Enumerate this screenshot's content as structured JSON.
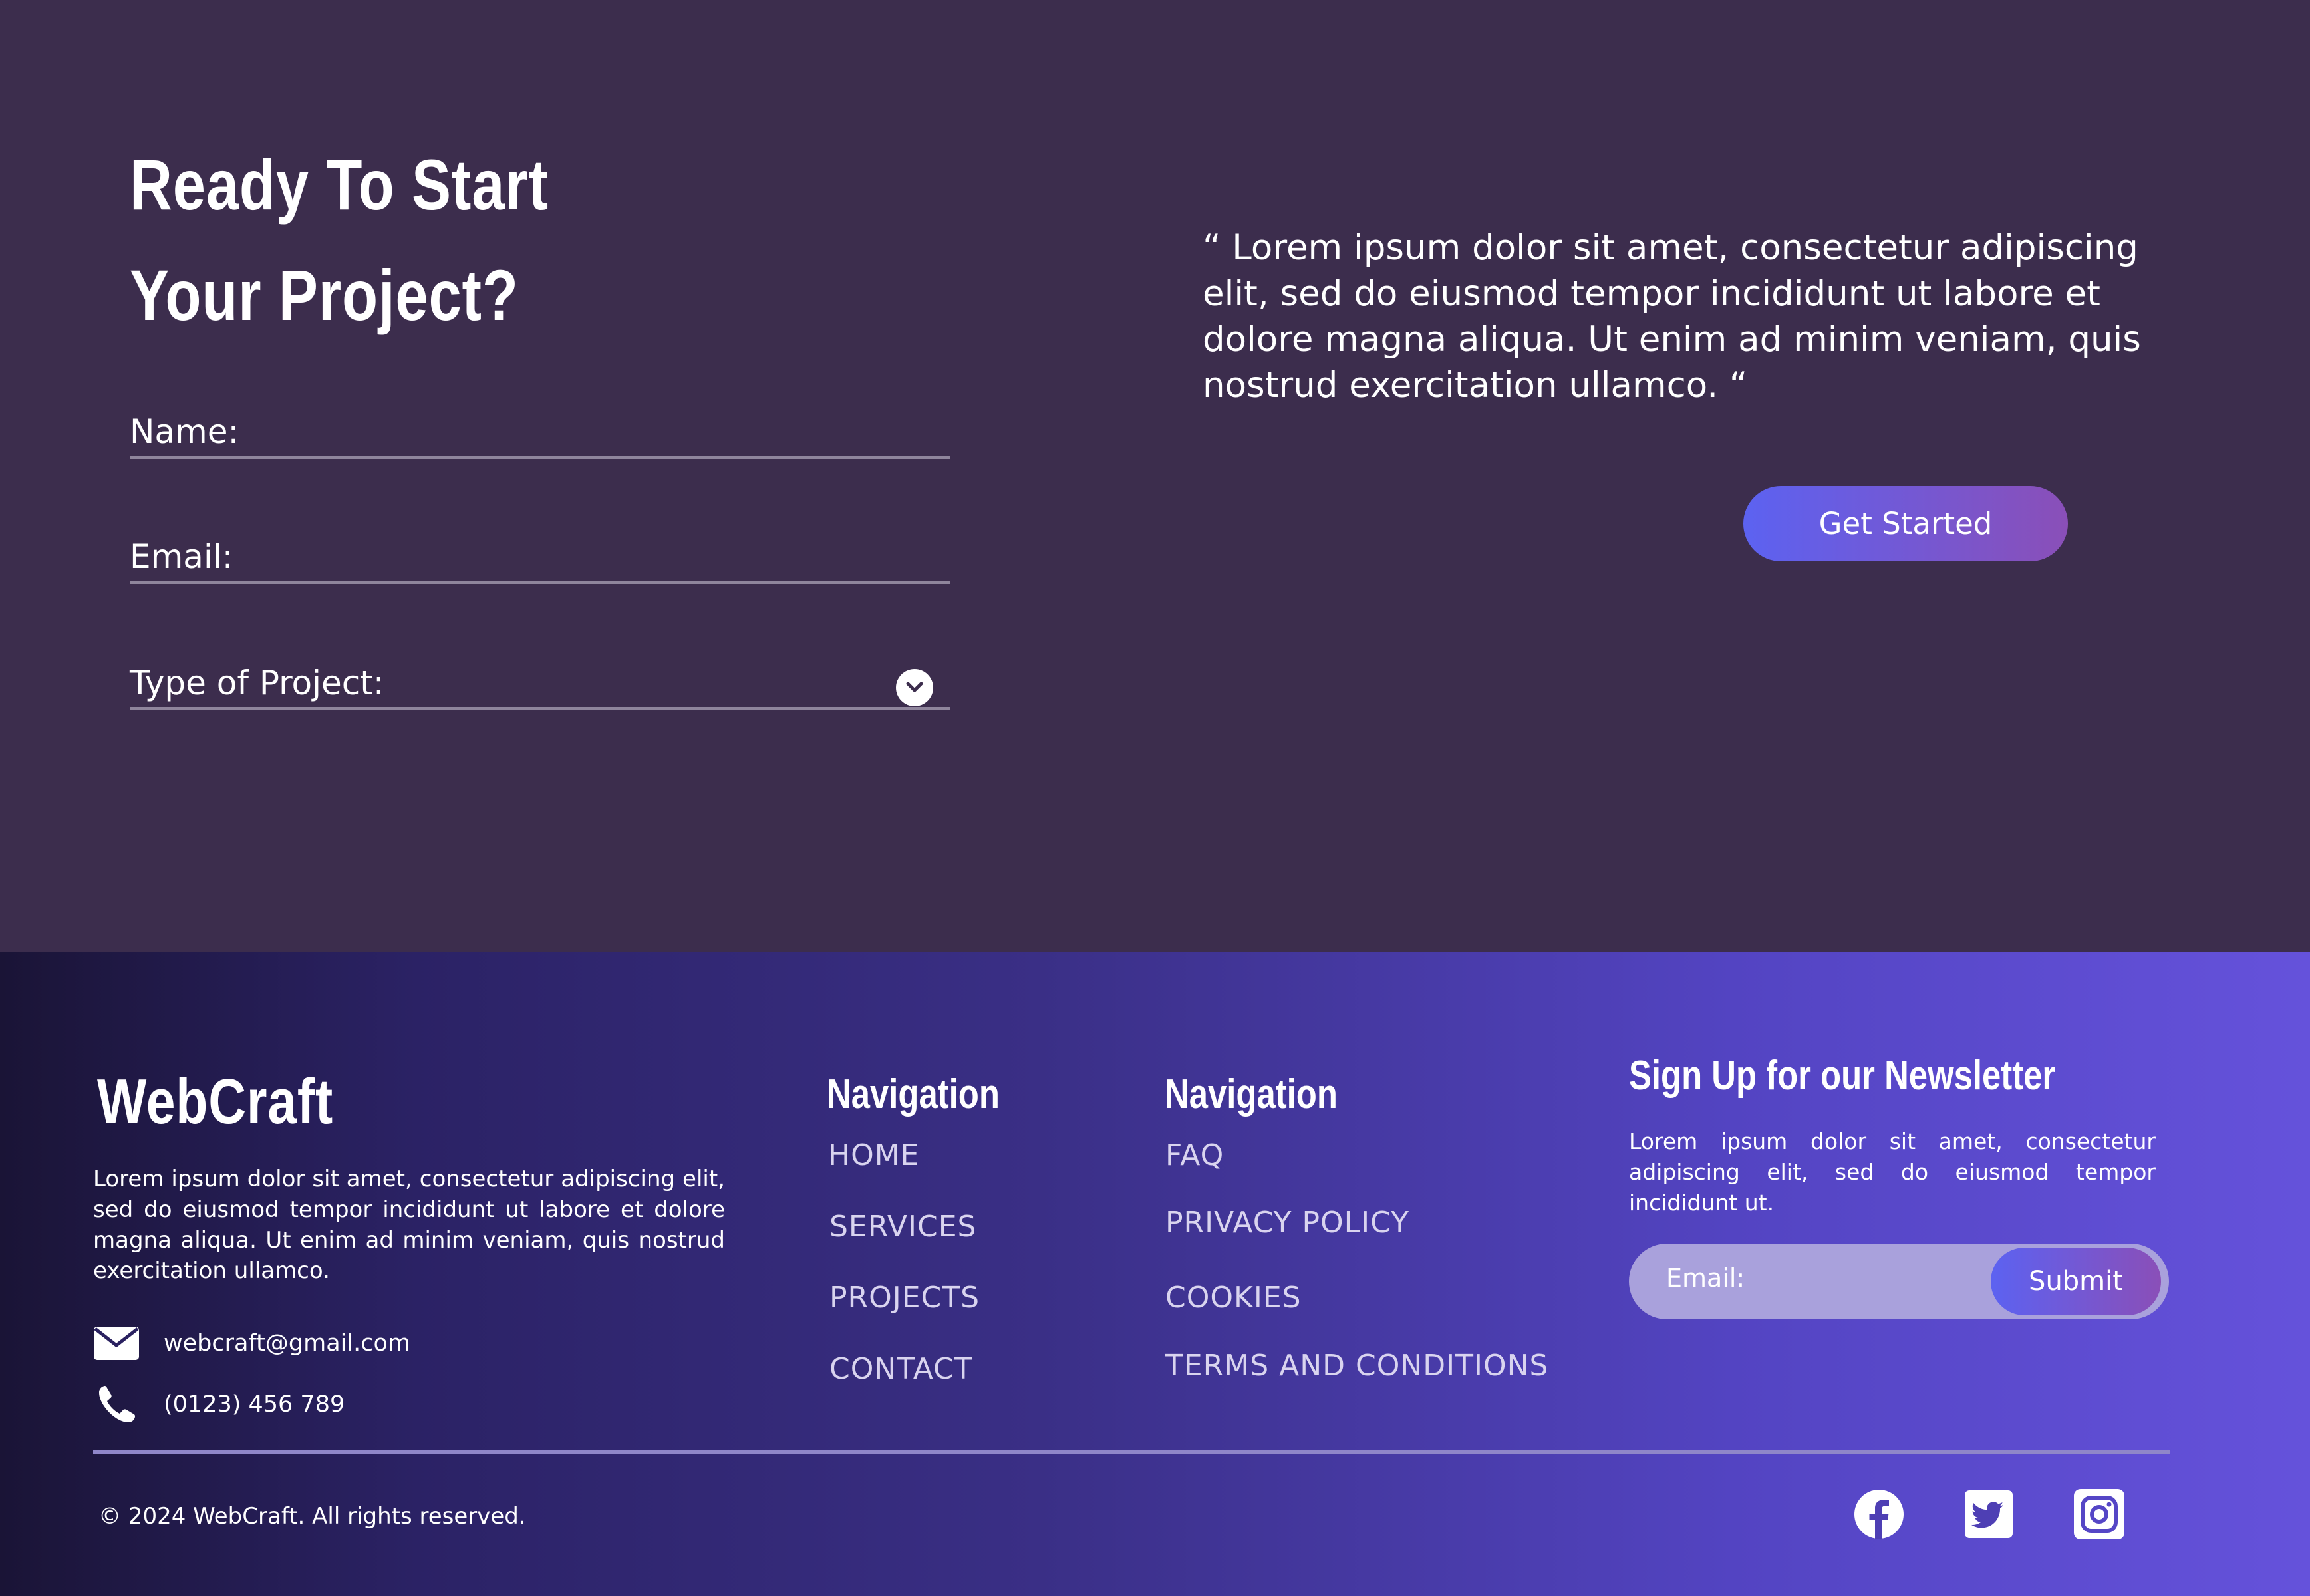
{
  "cta": {
    "title_line1": "Ready To Start",
    "title_line2": "Your Project?",
    "fields": {
      "name_label": "Name:",
      "email_label": "Email:",
      "type_label": "Type of Project:"
    },
    "quote": "“ Lorem ipsum dolor sit amet, consectetur adipiscing elit, sed do eiusmod tempor incididunt ut labore et dolore magna aliqua. Ut enim ad minim veniam, quis nostrud exercitation ullamco. “",
    "button_label": "Get Started"
  },
  "footer": {
    "brand": "WebCraft",
    "description": "Lorem ipsum dolor sit amet, consectetur adipiscing elit, sed do eiusmod tempor incididunt ut labore et dolore magna aliqua. Ut enim ad minim veniam, quis nostrud exercitation ullamco.",
    "email": "webcraft@gmail.com",
    "phone": "(0123) 456 789",
    "nav1": {
      "title": "Navigation",
      "links": [
        "HOME",
        "SERVICES",
        "PROJECTS",
        "CONTACT"
      ]
    },
    "nav2": {
      "title": "Navigation",
      "links": [
        "FAQ",
        "PRIVACY POLICY",
        "COOKIES",
        "TERMS AND CONDITIONS"
      ]
    },
    "newsletter": {
      "title": "Sign Up for our Newsletter",
      "description": "Lorem ipsum dolor sit amet, consectetur adipiscing elit, sed do eiusmod tempor incididunt ut.",
      "input_placeholder": "Email:",
      "submit_label": "Submit"
    },
    "copyright": "© 2024 WebCraft. All rights reserved.",
    "social_icons": [
      "facebook-icon",
      "twitter-icon",
      "instagram-icon"
    ]
  },
  "colors": {
    "top_background": "#3c2d4d",
    "accent_start": "#5c62f1",
    "accent_end": "#8a4fb8",
    "footer_dark": "#1a1436",
    "footer_light": "#6552db"
  }
}
